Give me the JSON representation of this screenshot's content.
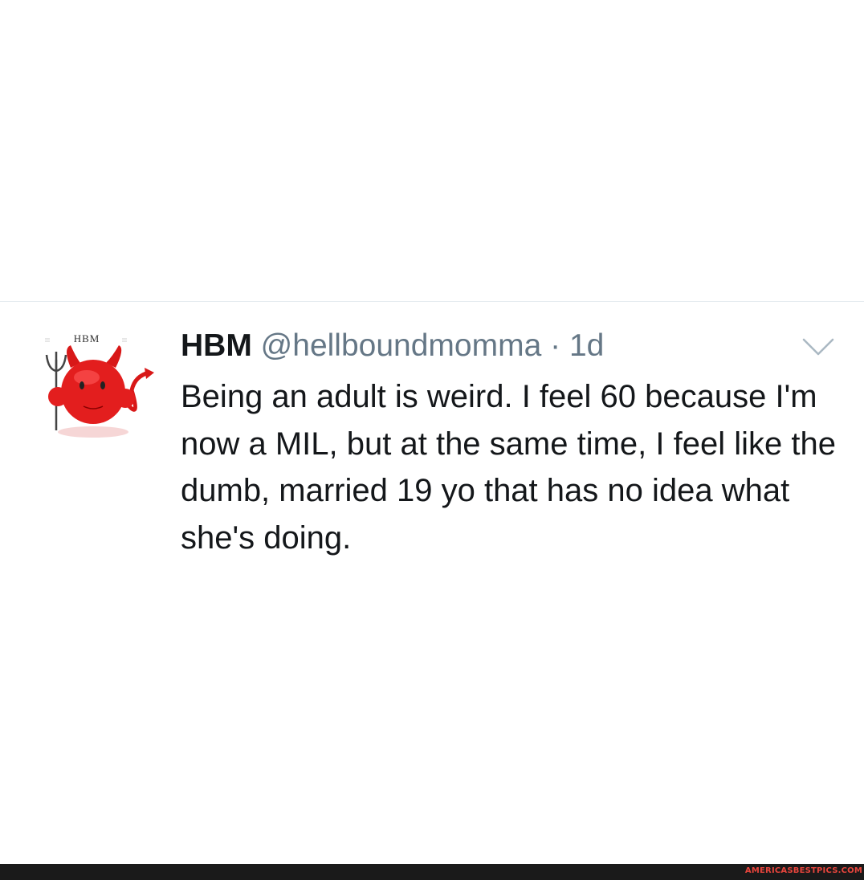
{
  "tweet": {
    "avatar_label": "HBM",
    "display_name": "HBM",
    "handle": "@hellboundmomma",
    "separator": "·",
    "timestamp": "1d",
    "text": "Being an adult is weird. I feel 60 because I'm now a MIL, but at the same time, I feel like the dumb, married 19 yo that has no idea what she's doing.",
    "menu_icon": "chevron-down-icon",
    "avatar_icon": "devil-avatar-icon"
  },
  "footer": {
    "watermark": "AMERICASBESTPICS.COM"
  },
  "colors": {
    "accent_red": "#e8453c",
    "avatar_red": "#e31e1e",
    "text_primary": "#14171a",
    "text_secondary": "#657786",
    "divider": "#e6ecf0",
    "footer_bg": "#1a1a1a"
  }
}
